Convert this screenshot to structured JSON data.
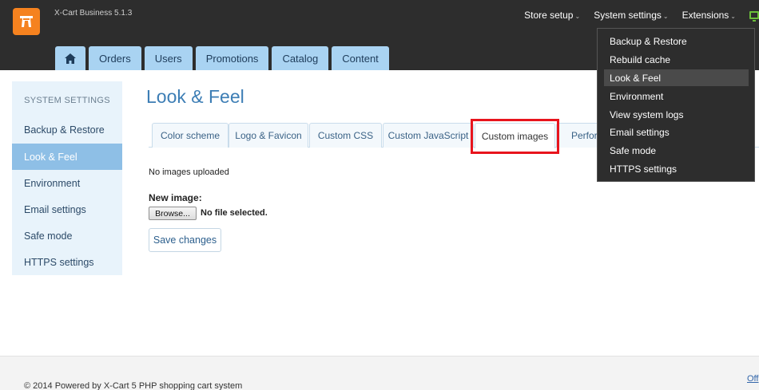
{
  "header": {
    "app_version": "X-Cart Business 5.1.3",
    "top_menu": [
      {
        "label": "Store setup",
        "caret": "⌄"
      },
      {
        "label": "System settings",
        "caret": "⌄"
      },
      {
        "label": "Extensions",
        "caret": "⌄"
      }
    ],
    "nav_tabs": [
      "Orders",
      "Users",
      "Promotions",
      "Catalog",
      "Content"
    ],
    "home_icon": "home-icon"
  },
  "sidebar": {
    "title": "SYSTEM SETTINGS",
    "items": [
      {
        "label": "Backup & Restore"
      },
      {
        "label": "Look & Feel"
      },
      {
        "label": "Environment"
      },
      {
        "label": "Email settings"
      },
      {
        "label": "Safe mode"
      },
      {
        "label": "HTTPS settings"
      }
    ]
  },
  "main": {
    "title": "Look & Feel",
    "tabs": [
      "Color scheme",
      "Logo & Favicon",
      "Custom CSS",
      "Custom JavaScript",
      "Custom images",
      "Perform"
    ],
    "active_tab": "Custom images",
    "no_images_text": "No images uploaded",
    "new_image_label": "New image:",
    "browse_label": "Browse...",
    "file_status": "No file selected.",
    "save_label": "Save changes"
  },
  "dropdown": {
    "items": [
      "Backup & Restore",
      "Rebuild cache",
      "Look & Feel",
      "Environment",
      "View system logs",
      "Email settings",
      "Safe mode",
      "HTTPS settings"
    ],
    "active": "Look & Feel"
  },
  "footer": {
    "copyright": "© 2014 Powered by X-Cart 5 PHP shopping cart system",
    "link": "Off"
  },
  "colors": {
    "header_bg": "#2d2d2d",
    "accent_orange": "#f5821f",
    "nav_tab_bg": "#a9d3f2",
    "sidebar_active": "#8ebfe6",
    "highlight": "#e8141d"
  }
}
